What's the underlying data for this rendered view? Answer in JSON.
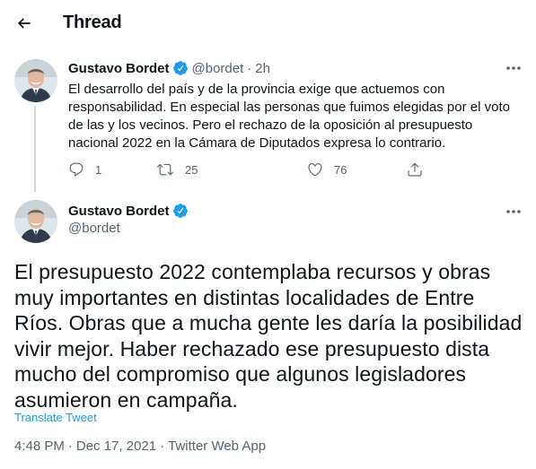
{
  "header": {
    "title": "Thread",
    "back_icon": "arrow-left-icon"
  },
  "colors": {
    "accent": "#1d9bf0",
    "text": "#0f1419",
    "muted": "#536471",
    "line": "#cfd9de"
  },
  "tweet1": {
    "name": "Gustavo Bordet",
    "handle": "@bordet",
    "separator": "·",
    "time": "2h",
    "text": "El desarrollo del país y de la provincia exige que actuemos con responsabilidad. En especial las personas que fuimos elegidas por el voto de las y los vecinos. Pero el rechazo de la oposición al presupuesto nacional 2022 en la Cámara de Diputados expresa lo contrario.",
    "replies": "1",
    "retweets": "25",
    "likes": "76"
  },
  "tweet2": {
    "name": "Gustavo Bordet",
    "handle": "@bordet",
    "text": "El presupuesto 2022 contemplaba recursos y obras muy importantes en distintas localidades de Entre Ríos. Obras que a mucha gente les daría la posibilidad vivir mejor. Haber rechazado ese presupuesto dista mucho del compromiso que algunos legisladores asumieron en campaña.",
    "translate_label": "Translate Tweet",
    "time": "4:48 PM",
    "date": "Dec 17, 2021",
    "source": "Twitter Web App",
    "separator": "·"
  }
}
